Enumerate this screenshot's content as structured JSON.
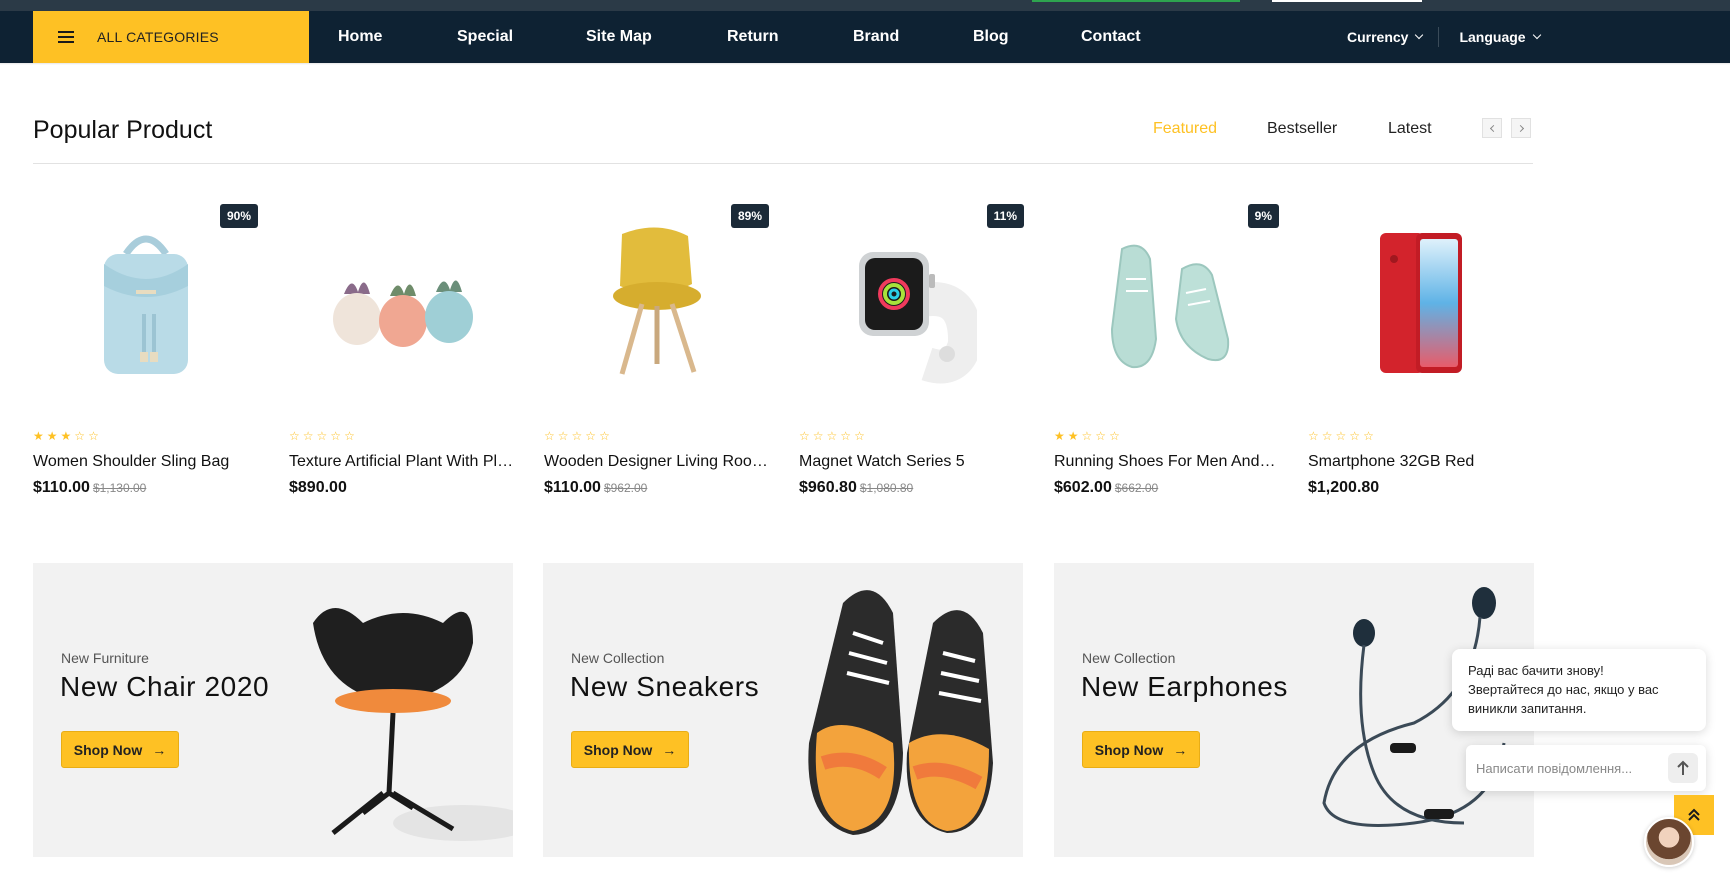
{
  "nav": {
    "all_categories": "ALL CATEGORIES",
    "links": [
      "Home",
      "Special",
      "Site Map",
      "Return",
      "Brand",
      "Blog",
      "Contact"
    ],
    "currency": "Currency",
    "language": "Language"
  },
  "section": {
    "title": "Popular Product",
    "tabs": [
      "Featured",
      "Bestseller",
      "Latest"
    ],
    "active_tab": "Featured"
  },
  "products": [
    {
      "name": "Women Shoulder Sling Bag",
      "price": "$110.00",
      "old_price": "$1,130.00",
      "badge": "90%",
      "rating": 3,
      "image": "backpack"
    },
    {
      "name": "Texture Artificial Plant With Planter Pots",
      "price": "$890.00",
      "old_price": "",
      "badge": "",
      "rating": 0,
      "image": "succulents"
    },
    {
      "name": "Wooden Designer Living Room Chair",
      "price": "$110.00",
      "old_price": "$962.00",
      "badge": "89%",
      "rating": 0,
      "image": "yellow-chair"
    },
    {
      "name": "Magnet Watch Series 5",
      "price": "$960.80",
      "old_price": "$1,080.80",
      "badge": "11%",
      "rating": 0,
      "image": "smartwatch"
    },
    {
      "name": "Running Shoes For Men And Women",
      "price": "$602.00",
      "old_price": "$662.00",
      "badge": "9%",
      "rating": 2,
      "image": "sneakers"
    },
    {
      "name": "Smartphone 32GB Red",
      "price": "$1,200.80",
      "old_price": "",
      "badge": "",
      "rating": 0,
      "image": "red-phone"
    }
  ],
  "banners": [
    {
      "subtitle": "New Furniture",
      "title": "New Chair 2020",
      "button": "Shop Now",
      "image": "black-chair"
    },
    {
      "subtitle": "New Collection",
      "title": "New Sneakers",
      "button": "Shop Now",
      "image": "sneakers-pair"
    },
    {
      "subtitle": "New Collection",
      "title": "New Earphones",
      "button": "Shop Now",
      "image": "earphones"
    }
  ],
  "chat": {
    "message_line1": "Раді вас бачити знову!",
    "message_line2": "Звертайтеся до нас, якщо у вас виникли запитання.",
    "input_placeholder": "Написати повідомлення..."
  },
  "colors": {
    "accent": "#fec124",
    "navbar": "#0e2233",
    "badge": "#1b2a38"
  }
}
